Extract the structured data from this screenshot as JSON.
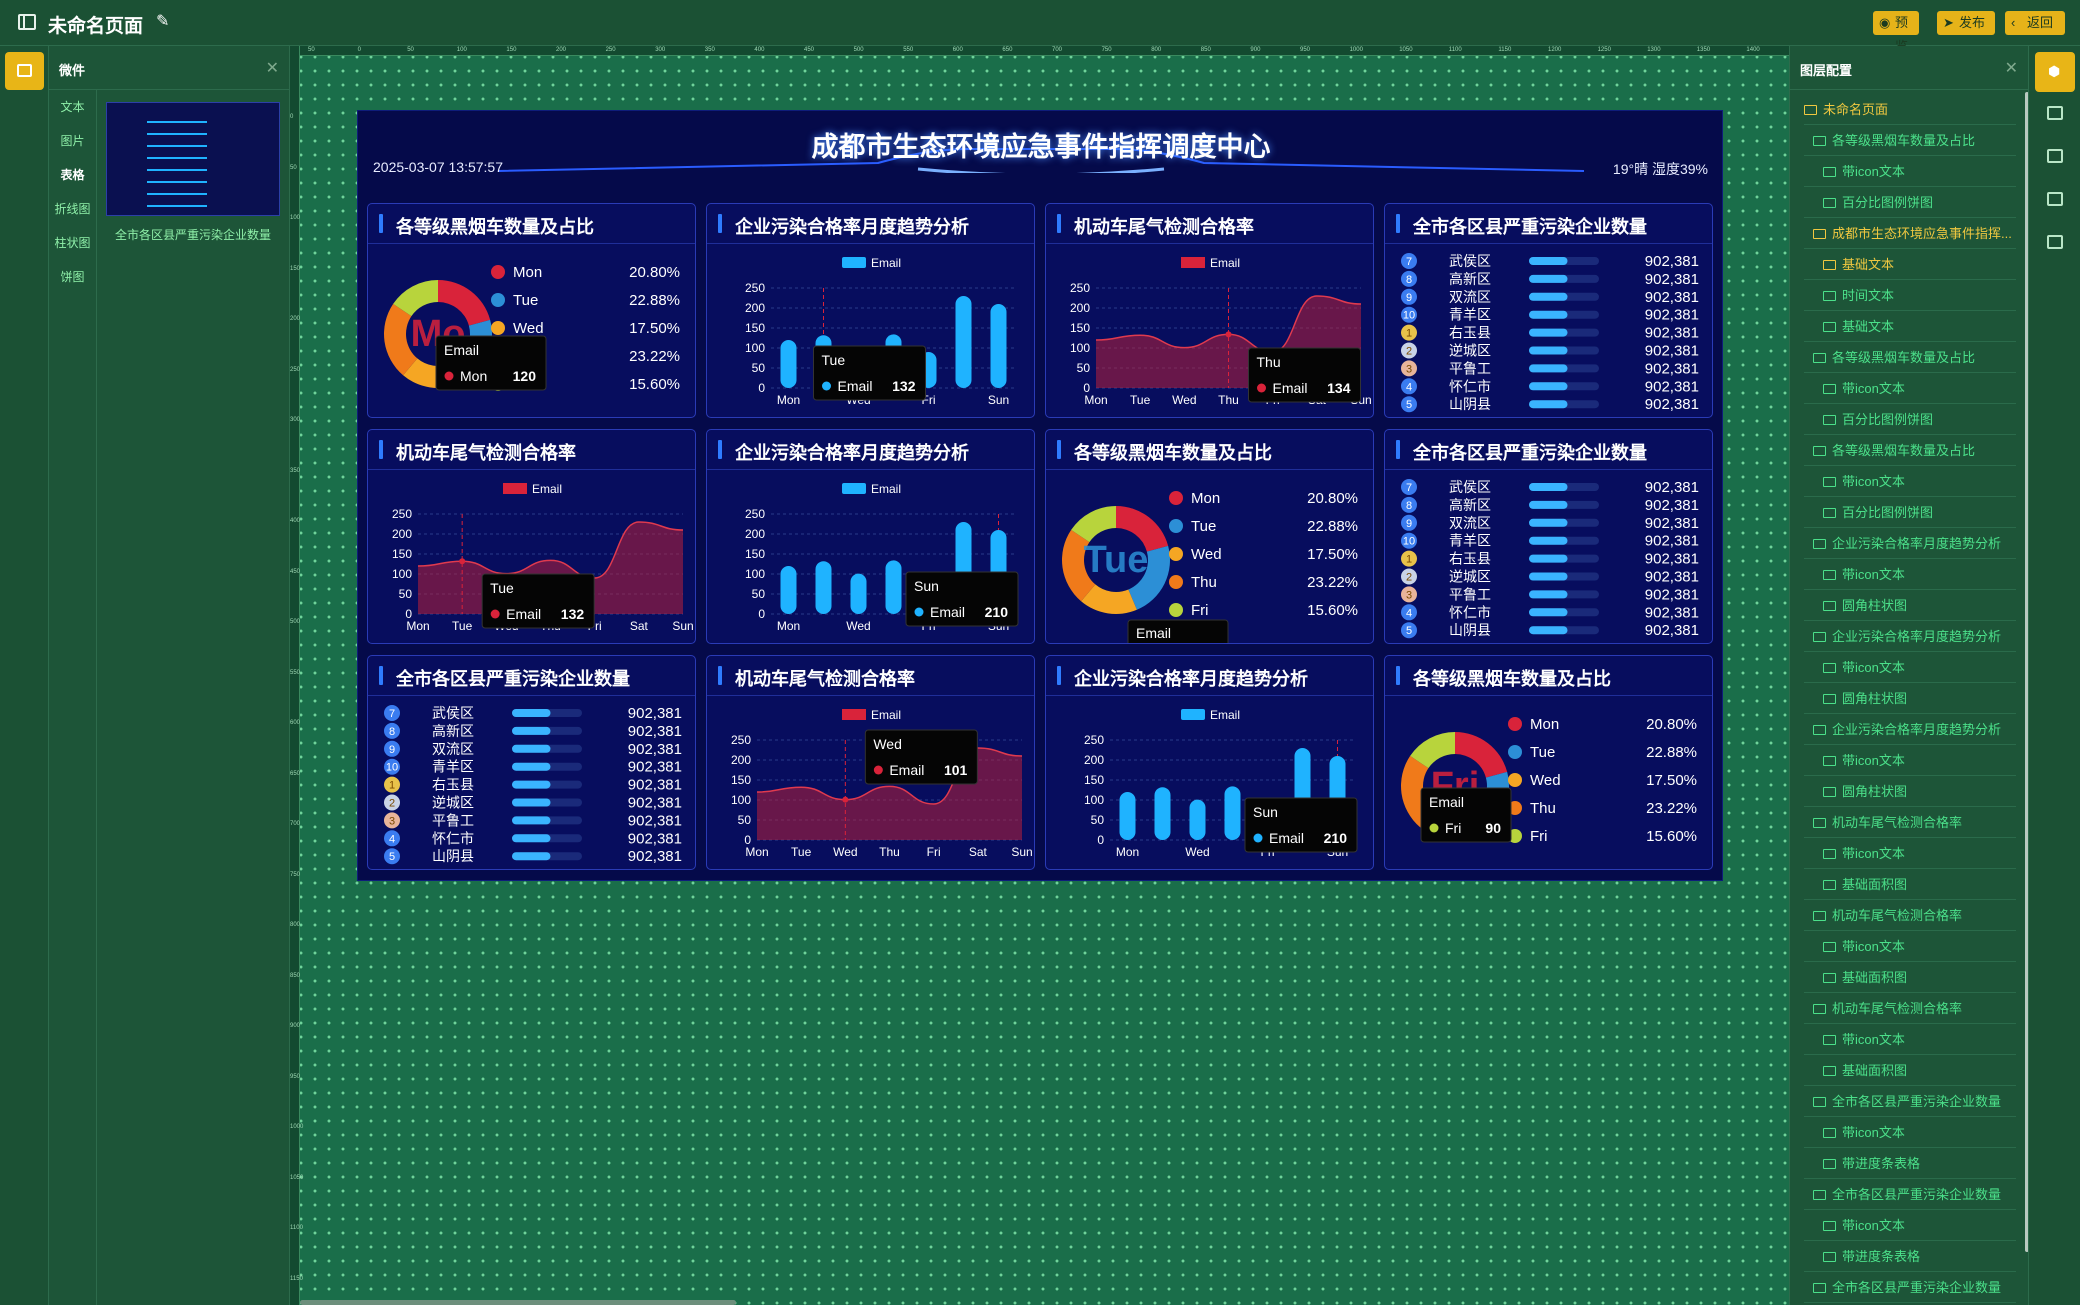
{
  "topbar": {
    "title": "未命名页面",
    "buttons": [
      {
        "label": "预览",
        "icon": "eye-icon"
      },
      {
        "label": "发布",
        "icon": "send-icon"
      },
      {
        "label": "返回",
        "icon": "back-icon"
      }
    ]
  },
  "widget_panel": {
    "title": "微件",
    "categories": [
      "文本",
      "图片",
      "表格",
      "折线图",
      "柱状图",
      "饼图"
    ],
    "active_category": "表格",
    "item_label": "全市各区县严重污染企业数量"
  },
  "layer_panel": {
    "title": "图层配置",
    "layers": [
      {
        "level": 0,
        "label": "未命名页面"
      },
      {
        "level": 1,
        "label": "各等级黑烟车数量及占比"
      },
      {
        "level": 2,
        "label": "带icon文本"
      },
      {
        "level": 2,
        "label": "百分比图例饼图"
      },
      {
        "level": 1,
        "label": "成都市生态环境应急事件指挥...",
        "highlight": true
      },
      {
        "level": 2,
        "label": "基础文本",
        "highlight": true
      },
      {
        "level": 2,
        "label": "时间文本"
      },
      {
        "level": 2,
        "label": "基础文本"
      },
      {
        "level": 1,
        "label": "各等级黑烟车数量及占比"
      },
      {
        "level": 2,
        "label": "带icon文本"
      },
      {
        "level": 2,
        "label": "百分比图例饼图"
      },
      {
        "level": 1,
        "label": "各等级黑烟车数量及占比"
      },
      {
        "level": 2,
        "label": "带icon文本"
      },
      {
        "level": 2,
        "label": "百分比图例饼图"
      },
      {
        "level": 1,
        "label": "企业污染合格率月度趋势分析"
      },
      {
        "level": 2,
        "label": "带icon文本"
      },
      {
        "level": 2,
        "label": "圆角柱状图"
      },
      {
        "level": 1,
        "label": "企业污染合格率月度趋势分析"
      },
      {
        "level": 2,
        "label": "带icon文本"
      },
      {
        "level": 2,
        "label": "圆角柱状图"
      },
      {
        "level": 1,
        "label": "企业污染合格率月度趋势分析"
      },
      {
        "level": 2,
        "label": "带icon文本"
      },
      {
        "level": 2,
        "label": "圆角柱状图"
      },
      {
        "level": 1,
        "label": "机动车尾气检测合格率"
      },
      {
        "level": 2,
        "label": "带icon文本"
      },
      {
        "level": 2,
        "label": "基础面积图"
      },
      {
        "level": 1,
        "label": "机动车尾气检测合格率"
      },
      {
        "level": 2,
        "label": "带icon文本"
      },
      {
        "level": 2,
        "label": "基础面积图"
      },
      {
        "level": 1,
        "label": "机动车尾气检测合格率"
      },
      {
        "level": 2,
        "label": "带icon文本"
      },
      {
        "level": 2,
        "label": "基础面积图"
      },
      {
        "level": 1,
        "label": "全市各区县严重污染企业数量"
      },
      {
        "level": 2,
        "label": "带icon文本"
      },
      {
        "level": 2,
        "label": "带进度条表格"
      },
      {
        "level": 1,
        "label": "全市各区县严重污染企业数量"
      },
      {
        "level": 2,
        "label": "带icon文本"
      },
      {
        "level": 2,
        "label": "带进度条表格"
      },
      {
        "level": 1,
        "label": "全市各区县严重污染企业数量"
      }
    ]
  },
  "ruler": {
    "h_ticks": [
      "50",
      "0",
      "50",
      "100",
      "150",
      "200",
      "250",
      "300",
      "350",
      "400",
      "450",
      "500",
      "550",
      "600",
      "650",
      "700",
      "750",
      "800",
      "850",
      "900",
      "950",
      "1000",
      "1050",
      "1100",
      "1150",
      "1200",
      "1250",
      "1300",
      "1350",
      "1400"
    ],
    "v_ticks": [
      "0",
      "50",
      "100",
      "150",
      "200",
      "250",
      "300",
      "350",
      "400",
      "450",
      "500",
      "550",
      "600",
      "650",
      "700",
      "750",
      "800",
      "850",
      "900",
      "950",
      "1000",
      "1050",
      "1100",
      "1150"
    ]
  },
  "dashboard": {
    "title": "成都市生态环境应急事件指挥调度中心",
    "datetime": "2025-03-07 13:57:57",
    "weather": "19°晴 湿度39%"
  },
  "colors": {
    "accent": "#e8b517",
    "layer_green": "#4be08a",
    "dash_bg": "#050a4a",
    "bar_blue": "#1fb3ff",
    "area_red": "#b8203a"
  },
  "panels": [
    {
      "type": "pie",
      "title": "各等级黑烟车数量及占比",
      "tooltip": {
        "title": "Email",
        "series": "Mon",
        "value": "120"
      },
      "overlay": "Mo"
    },
    {
      "type": "bar",
      "title": "企业污染合格率月度趋势分析",
      "tooltip": {
        "title": "Tue",
        "series": "Email",
        "value": "132"
      },
      "cursor": 1
    },
    {
      "type": "area",
      "title": "机动车尾气检测合格率",
      "tooltip": {
        "title": "Thu",
        "series": "Email",
        "value": "134"
      },
      "cursor": 3
    },
    {
      "type": "table",
      "title": "全市各区县严重污染企业数量"
    },
    {
      "type": "area",
      "title": "机动车尾气检测合格率",
      "tooltip": {
        "title": "Tue",
        "series": "Email",
        "value": "132"
      },
      "cursor": 1
    },
    {
      "type": "bar",
      "title": "企业污染合格率月度趋势分析",
      "tooltip": {
        "title": "Sun",
        "series": "Email",
        "value": "210"
      },
      "cursor": 6
    },
    {
      "type": "pie",
      "title": "各等级黑烟车数量及占比",
      "tooltip": {
        "title": "Email",
        "series": "",
        "value": ""
      },
      "overlay": "Tue"
    },
    {
      "type": "table",
      "title": "全市各区县严重污染企业数量"
    },
    {
      "type": "table",
      "title": "全市各区县严重污染企业数量"
    },
    {
      "type": "area",
      "title": "机动车尾气检测合格率",
      "tooltip": {
        "title": "Wed",
        "series": "Email",
        "value": "101"
      },
      "cursor": 2
    },
    {
      "type": "bar",
      "title": "企业污染合格率月度趋势分析",
      "tooltip": {
        "title": "Sun",
        "series": "Email",
        "value": "210"
      },
      "cursor": 6
    },
    {
      "type": "pie",
      "title": "各等级黑烟车数量及占比",
      "tooltip": {
        "title": "Email",
        "series": "Fri",
        "value": "90"
      },
      "overlay": "Fri"
    }
  ],
  "chart_data": [
    {
      "type": "pie",
      "title": "各等级黑烟车数量及占比",
      "categories": [
        "Mon",
        "Tue",
        "Wed",
        "Thu",
        "Fri"
      ],
      "values": [
        20.8,
        22.88,
        17.5,
        23.22,
        15.6
      ],
      "labels": [
        "20.80%",
        "22.88%",
        "17.50%",
        "23.22%",
        "15.60%"
      ],
      "colors": [
        "#d9233a",
        "#2c8fd6",
        "#f5a623",
        "#f07a1a",
        "#b8d43c"
      ]
    },
    {
      "type": "bar",
      "title": "企业污染合格率月度趋势分析",
      "legend": "Email",
      "categories": [
        "Mon",
        "Tue",
        "Wed",
        "Thu",
        "Fri",
        "Sat",
        "Sun"
      ],
      "x_tick_labels": [
        "Mon",
        "Wed",
        "Fri",
        "Sun"
      ],
      "values": [
        120,
        132,
        101,
        134,
        90,
        230,
        210
      ],
      "ylim": [
        0,
        250
      ],
      "yticks": [
        0,
        50,
        100,
        150,
        200,
        250
      ]
    },
    {
      "type": "area",
      "title": "机动车尾气检测合格率",
      "legend": "Email",
      "categories": [
        "Mon",
        "Tue",
        "Wed",
        "Thu",
        "Fri",
        "Sat",
        "Sun"
      ],
      "values": [
        120,
        132,
        101,
        134,
        90,
        230,
        210
      ],
      "ylim": [
        0,
        250
      ],
      "yticks": [
        0,
        50,
        100,
        150,
        200,
        250
      ]
    },
    {
      "type": "table",
      "title": "全市各区县严重污染企业数量",
      "rows": [
        {
          "rank": "7",
          "name": "武侯区",
          "value": "902,381",
          "pct": 0.55
        },
        {
          "rank": "8",
          "name": "高新区",
          "value": "902,381",
          "pct": 0.55
        },
        {
          "rank": "9",
          "name": "双流区",
          "value": "902,381",
          "pct": 0.55
        },
        {
          "rank": "10",
          "name": "青羊区",
          "value": "902,381",
          "pct": 0.55
        },
        {
          "rank": "1",
          "name": "右玉县",
          "value": "902,381",
          "pct": 0.55
        },
        {
          "rank": "2",
          "name": "逆城区",
          "value": "902,381",
          "pct": 0.55
        },
        {
          "rank": "3",
          "name": "平鲁工",
          "value": "902,381",
          "pct": 0.55
        },
        {
          "rank": "4",
          "name": "怀仁市",
          "value": "902,381",
          "pct": 0.55
        },
        {
          "rank": "5",
          "name": "山阴县",
          "value": "902,381",
          "pct": 0.55
        }
      ]
    }
  ]
}
